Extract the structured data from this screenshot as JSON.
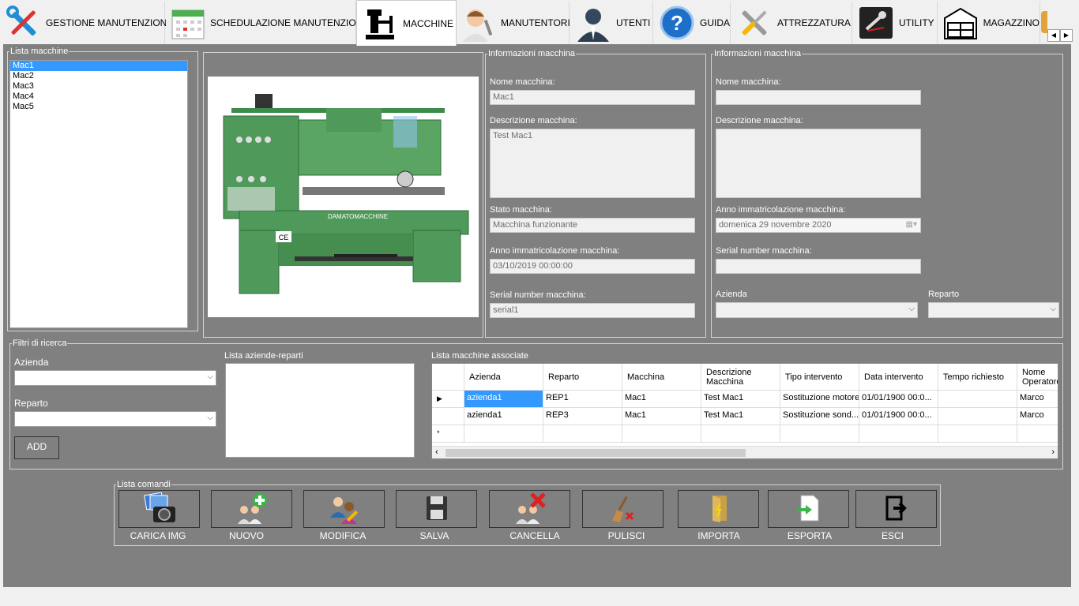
{
  "tabs": [
    {
      "label": "GESTIONE MANUTENZIONI",
      "icon": "tools-icon"
    },
    {
      "label": "SCHEDULAZIONE MANUTENZIONI",
      "icon": "calendar-icon"
    },
    {
      "label": "MACCHINE",
      "icon": "machine-icon"
    },
    {
      "label": "MANUTENTORI",
      "icon": "technician-icon"
    },
    {
      "label": "UTENTI",
      "icon": "user-icon"
    },
    {
      "label": "GUIDA",
      "icon": "help-icon"
    },
    {
      "label": "ATTREZZATURA",
      "icon": "wrench-screwdriver-icon"
    },
    {
      "label": "UTILITY",
      "icon": "utility-icon"
    },
    {
      "label": "MAGAZZINO",
      "icon": "warehouse-icon"
    }
  ],
  "machine_list": {
    "legend": "Lista macchine",
    "items": [
      "Mac1",
      "Mac2",
      "Mac3",
      "Mac4",
      "Mac5"
    ],
    "selected": "Mac1"
  },
  "info_left": {
    "legend": "Informazioni macchina",
    "name_label": "Nome macchina:",
    "name_value": "Mac1",
    "desc_label": "Descrizione macchina:",
    "desc_value": "Test Mac1",
    "state_label": "Stato macchina:",
    "state_value": "Macchina funzionante",
    "year_label": "Anno immatricolazione macchina:",
    "year_value": "03/10/2019 00:00:00",
    "serial_label": "Serial number macchina:",
    "serial_value": "serial1"
  },
  "info_right": {
    "legend": "Informazioni macchina",
    "name_label": "Nome macchina:",
    "desc_label": "Descrizione macchina:",
    "year_label": "Anno immatricolazione macchina:",
    "year_value": "domenica 29 novembre 2020",
    "serial_label": "Serial number macchina:",
    "azienda_label": "Azienda",
    "reparto_label": "Reparto"
  },
  "filters": {
    "legend": "Filtri di ricerca",
    "azienda_label": "Azienda",
    "reparto_label": "Reparto",
    "add_label": "ADD",
    "list_label": "Lista aziende-reparti"
  },
  "grid": {
    "label": "Lista macchine associate",
    "headers": [
      "Azienda",
      "Reparto",
      "Macchina",
      "Descrizione Macchina",
      "Tipo intervento",
      "Data intervento",
      "Tempo richiesto",
      "Nome Operatore"
    ],
    "rows": [
      [
        "azienda1",
        "REP1",
        "Mac1",
        "Test Mac1",
        "Sostituzione motore",
        "01/01/1900 00:0...",
        "",
        "Marco"
      ],
      [
        "azienda1",
        "REP3",
        "Mac1",
        "Test Mac1",
        "Sostituzione sond...",
        "01/01/1900 00:0...",
        "",
        "Marco"
      ]
    ]
  },
  "commands": {
    "legend": "Lista comandi",
    "buttons": [
      {
        "label": "CARICA IMG",
        "icon": "camera-photos-icon"
      },
      {
        "label": "NUOVO",
        "icon": "add-user-icon"
      },
      {
        "label": "MODIFICA",
        "icon": "edit-user-icon"
      },
      {
        "label": "SALVA",
        "icon": "floppy-icon"
      },
      {
        "label": "CANCELLA",
        "icon": "delete-user-icon"
      },
      {
        "label": "PULISCI",
        "icon": "broom-icon"
      },
      {
        "label": "IMPORTA",
        "icon": "import-door-icon"
      },
      {
        "label": "ESPORTA",
        "icon": "export-icon"
      },
      {
        "label": "ESCI",
        "icon": "exit-icon"
      }
    ]
  },
  "colors": {
    "panel": "#808080",
    "selection": "#3399ff",
    "machine_green": "#4f9a5a"
  }
}
